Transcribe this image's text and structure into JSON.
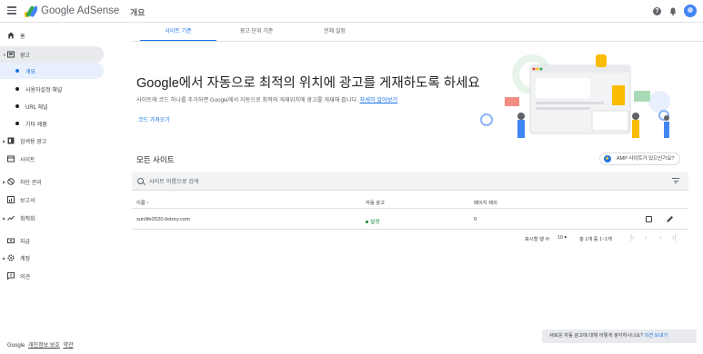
{
  "app": {
    "brand": "Google AdSense",
    "page_title": "개요"
  },
  "header": {
    "help_icon": "help-icon",
    "notification_icon": "bell-icon",
    "avatar_icon": "account-avatar"
  },
  "sidebar": {
    "items": [
      {
        "label": "홈",
        "icon": "home-icon"
      },
      {
        "label": "광고",
        "icon": "ads-icon"
      },
      {
        "label": "개요",
        "icon": "dot"
      },
      {
        "label": "사용자설정 채널",
        "icon": "dot"
      },
      {
        "label": "URL 채널",
        "icon": "dot"
      },
      {
        "label": "기타 제품",
        "icon": "dot"
      },
      {
        "label": "검색용 광고",
        "icon": "search-ads-icon"
      },
      {
        "label": "사이트",
        "icon": "sites-icon"
      },
      {
        "label": "차단 관리",
        "icon": "block-icon"
      },
      {
        "label": "보고서",
        "icon": "reports-icon"
      },
      {
        "label": "최적화",
        "icon": "optimize-icon"
      },
      {
        "label": "지급",
        "icon": "payments-icon"
      },
      {
        "label": "계정",
        "icon": "account-gear-icon"
      },
      {
        "label": "의견",
        "icon": "feedback-icon"
      }
    ],
    "footer": {
      "google": "Google",
      "privacy": "개인정보 보호",
      "terms": "약관"
    }
  },
  "tabs": [
    {
      "label": "사이트 기준",
      "active": true
    },
    {
      "label": "광고 단위 기준",
      "active": false
    },
    {
      "label": "전체 설정",
      "active": false
    }
  ],
  "hero": {
    "title": "Google에서 자동으로 최적의 위치에 광고를 게재하도록 하세요",
    "description": "사이트에 코드 하나를 추가하면 Google에서 자동으로 최적의 게재위치에 광고를 게재해 줍니다.",
    "learn_more": "자세히 알아보기",
    "get_code": "코드 가져오기"
  },
  "sites": {
    "title": "모든 사이트",
    "amp_button": "AMP 사이트가 있으신가요?",
    "search_placeholder": "사이트 이름으로 검색",
    "columns": {
      "name": "이름 ↑",
      "auto_ads": "자동 광고",
      "page_exclusion": "페이지 제외"
    },
    "rows": [
      {
        "name": "sunlife2020.tistory.com",
        "auto_ads": "설정",
        "page_exclusion": "0"
      }
    ],
    "pagination": {
      "rows_per_page_label": "표시할 행 수:",
      "rows_per_page": "10",
      "range": "총 1개 중 1~1개"
    }
  },
  "feedback": {
    "text": "새로운 자동 광고에 대해 어떻게 생각하시나요?",
    "link": "의견 보내기"
  },
  "colors": {
    "accent": "#1a73e8",
    "status_green": "#188038",
    "sidebar_active_bg": "#e8f0fe"
  }
}
